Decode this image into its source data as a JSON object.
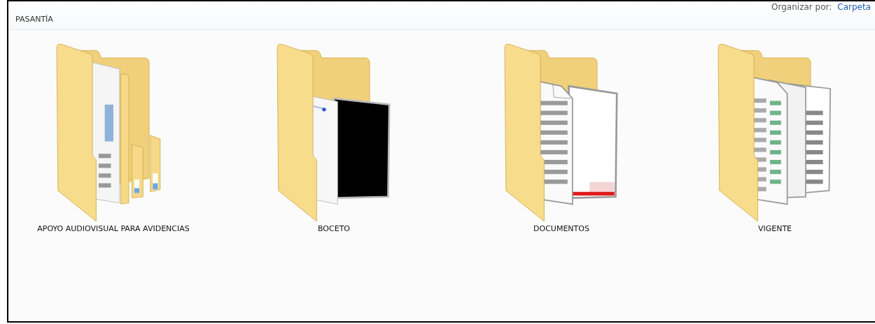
{
  "header": {
    "title": "PASANTÍA",
    "sort_label": "Organizar por:",
    "sort_value": "Carpeta"
  },
  "folders": [
    {
      "name": "APOYO AUDIOVISUAL PARA AVIDENCIAS",
      "kind": "pages"
    },
    {
      "name": "BOCETO",
      "kind": "sheets"
    },
    {
      "name": "DOCUMENTOS",
      "kind": "documents"
    },
    {
      "name": "VIGENTE",
      "kind": "spreadsheets"
    }
  ]
}
